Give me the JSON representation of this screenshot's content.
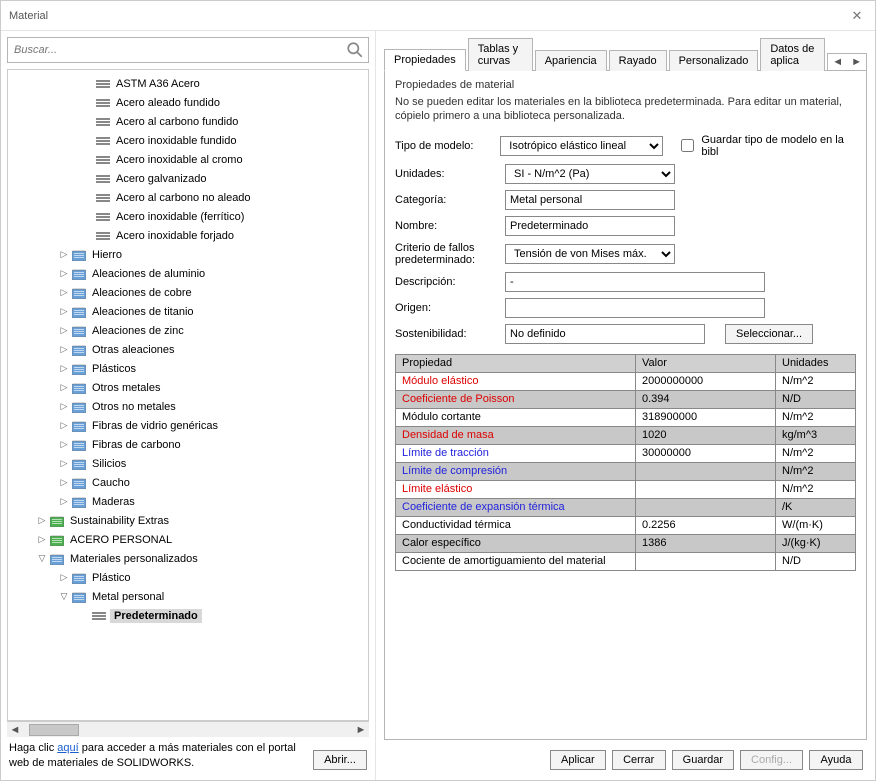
{
  "window": {
    "title": "Material"
  },
  "search": {
    "placeholder": "Buscar..."
  },
  "tree": {
    "mat_items": [
      "ASTM A36 Acero",
      "Acero aleado fundido",
      "Acero al carbono fundido",
      "Acero inoxidable fundido",
      "Acero inoxidable al cromo",
      "Acero galvanizado",
      "Acero al carbono no aleado",
      "Acero inoxidable (ferrítico)",
      "Acero inoxidable forjado"
    ],
    "folders1": [
      "Hierro",
      "Aleaciones de aluminio",
      "Aleaciones de cobre",
      "Aleaciones de titanio",
      "Aleaciones de zinc",
      "Otras aleaciones",
      "Plásticos",
      "Otros metales",
      "Otros no metales",
      "Fibras de vidrio genéricas",
      "Fibras de carbono",
      "Silicios",
      "Caucho",
      "Maderas"
    ],
    "sustain": "Sustainability Extras",
    "acero": "ACERO PERSONAL",
    "custom": "Materiales personalizados",
    "plastico": "Plástico",
    "metal": "Metal personal",
    "predet": "Predeterminado"
  },
  "left_footer": {
    "t1": "Haga clic ",
    "link": "aquí",
    "t2": " para acceder a más materiales con el portal web de materiales de SOLIDWORKS.",
    "open": "Abrir..."
  },
  "tabs": [
    "Propiedades",
    "Tablas y curvas",
    "Apariencia",
    "Rayado",
    "Personalizado",
    "Datos de aplica"
  ],
  "group": {
    "title": "Propiedades de material",
    "note": "No se pueden editar los materiales en la biblioteca predeterminada. Para editar un material, cópielo primero a una biblioteca personalizada."
  },
  "form": {
    "tipo_l": "Tipo de modelo:",
    "tipo_v": "Isotrópico elástico lineal",
    "save_chk": "Guardar tipo de modelo en la bibl",
    "unid_l": "Unidades:",
    "unid_v": "SI - N/m^2 (Pa)",
    "cat_l": "Categoría:",
    "cat_v": "Metal personal",
    "nom_l": "Nombre:",
    "nom_v": "Predeterminado",
    "crit_l1": "Criterio de fallos",
    "crit_l2": "predeterminado:",
    "crit_v": "Tensión de von Mises máx.",
    "desc_l": "Descripción:",
    "desc_v": "-",
    "orig_l": "Origen:",
    "orig_v": "",
    "sost_l": "Sostenibilidad:",
    "sost_v": "No definido",
    "sel_btn": "Seleccionar..."
  },
  "table": {
    "h1": "Propiedad",
    "h2": "Valor",
    "h3": "Unidades",
    "rows": [
      {
        "p": "Módulo elástico",
        "cls": "red",
        "v": "2000000000",
        "u": "N/m^2"
      },
      {
        "p": "Coeficiente de Poisson",
        "cls": "red",
        "v": "0.394",
        "u": "N/D"
      },
      {
        "p": "Módulo cortante",
        "cls": "",
        "v": "318900000",
        "u": "N/m^2"
      },
      {
        "p": "Densidad de masa",
        "cls": "red",
        "v": "1020",
        "u": "kg/m^3"
      },
      {
        "p": "Límite de tracción",
        "cls": "blue",
        "v": "30000000",
        "u": "N/m^2"
      },
      {
        "p": "Límite de compresión",
        "cls": "blue",
        "v": "",
        "u": "N/m^2"
      },
      {
        "p": "Límite elástico",
        "cls": "red",
        "v": "",
        "u": "N/m^2"
      },
      {
        "p": "Coeficiente de expansión térmica",
        "cls": "blue",
        "v": "",
        "u": "/K"
      },
      {
        "p": "Conductividad térmica",
        "cls": "",
        "v": "0.2256",
        "u": "W/(m·K)"
      },
      {
        "p": "Calor específico",
        "cls": "",
        "v": "1386",
        "u": "J/(kg·K)"
      },
      {
        "p": "Cociente de amortiguamiento del material",
        "cls": "",
        "v": "",
        "u": "N/D"
      }
    ]
  },
  "buttons": {
    "aplicar": "Aplicar",
    "cerrar": "Cerrar",
    "guardar": "Guardar",
    "config": "Config...",
    "ayuda": "Ayuda"
  }
}
